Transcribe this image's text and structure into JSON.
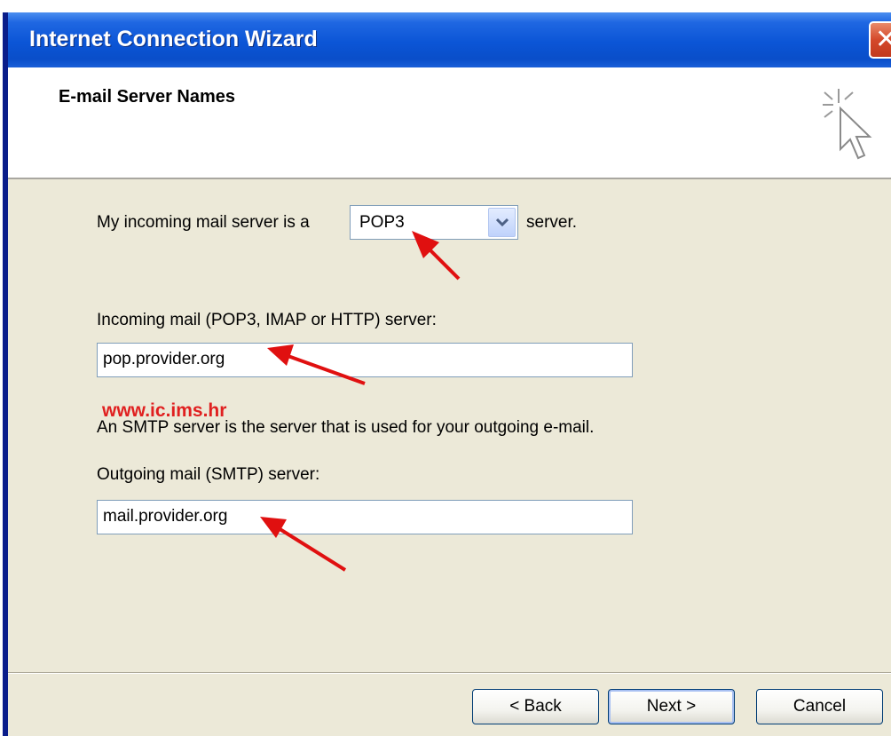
{
  "window": {
    "title": "Internet Connection Wizard",
    "close_glyph": "✕"
  },
  "header": {
    "heading": "E-mail Server Names",
    "icon": "wizard-cursor-icon"
  },
  "form": {
    "incoming_type_prefix": "My incoming mail server is a",
    "incoming_type_value": "POP3",
    "incoming_type_suffix": "server.",
    "incoming_label": "Incoming mail (POP3, IMAP or HTTP) server:",
    "incoming_value": "pop.provider.org",
    "watermark": "www.ic.ims.hr",
    "smtp_description": "An SMTP server is the server that is used for your outgoing e-mail.",
    "outgoing_label": "Outgoing mail (SMTP) server:",
    "outgoing_value": "mail.provider.org"
  },
  "buttons": {
    "back": "< Back",
    "next": "Next >",
    "cancel": "Cancel"
  },
  "colors": {
    "titlebar": "#0b55d6",
    "dialog_bg": "#ece9d8",
    "annotation_arrow": "#e01010",
    "watermark": "#e02020"
  }
}
